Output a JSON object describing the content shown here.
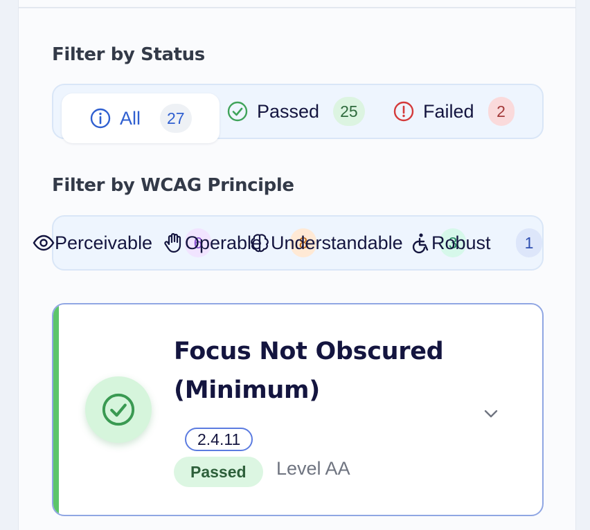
{
  "status_filter": {
    "title": "Filter by Status",
    "options": [
      {
        "label": "All",
        "count": "27",
        "icon": "info-circle-icon",
        "active": true
      },
      {
        "label": "Passed",
        "count": "25",
        "icon": "check-circle-icon",
        "active": false
      },
      {
        "label": "Failed",
        "count": "2",
        "icon": "alert-circle-icon",
        "active": false
      }
    ]
  },
  "wcag_filter": {
    "title": "Filter by WCAG Principle",
    "options": [
      {
        "label": "Perceivable",
        "count": "6",
        "icon": "eye-icon"
      },
      {
        "label": "Operable",
        "count": "8",
        "icon": "hand-icon"
      },
      {
        "label": "Understandable",
        "count": "3",
        "icon": "brain-icon"
      },
      {
        "label": "Robust",
        "count": "1",
        "icon": "accessibility-icon"
      }
    ]
  },
  "result_card": {
    "title": "Focus Not Obscured (Minimum)",
    "criterion": "2.4.11",
    "status": "Passed",
    "level": "Level AA",
    "icon": "check-circle-icon",
    "expand_icon": "chevron-down-icon"
  },
  "colors": {
    "accent_blue": "#2f5fd0",
    "pass_green": "#3fa35a",
    "fail_red": "#d43a3a",
    "card_border": "#8fa6e3"
  }
}
